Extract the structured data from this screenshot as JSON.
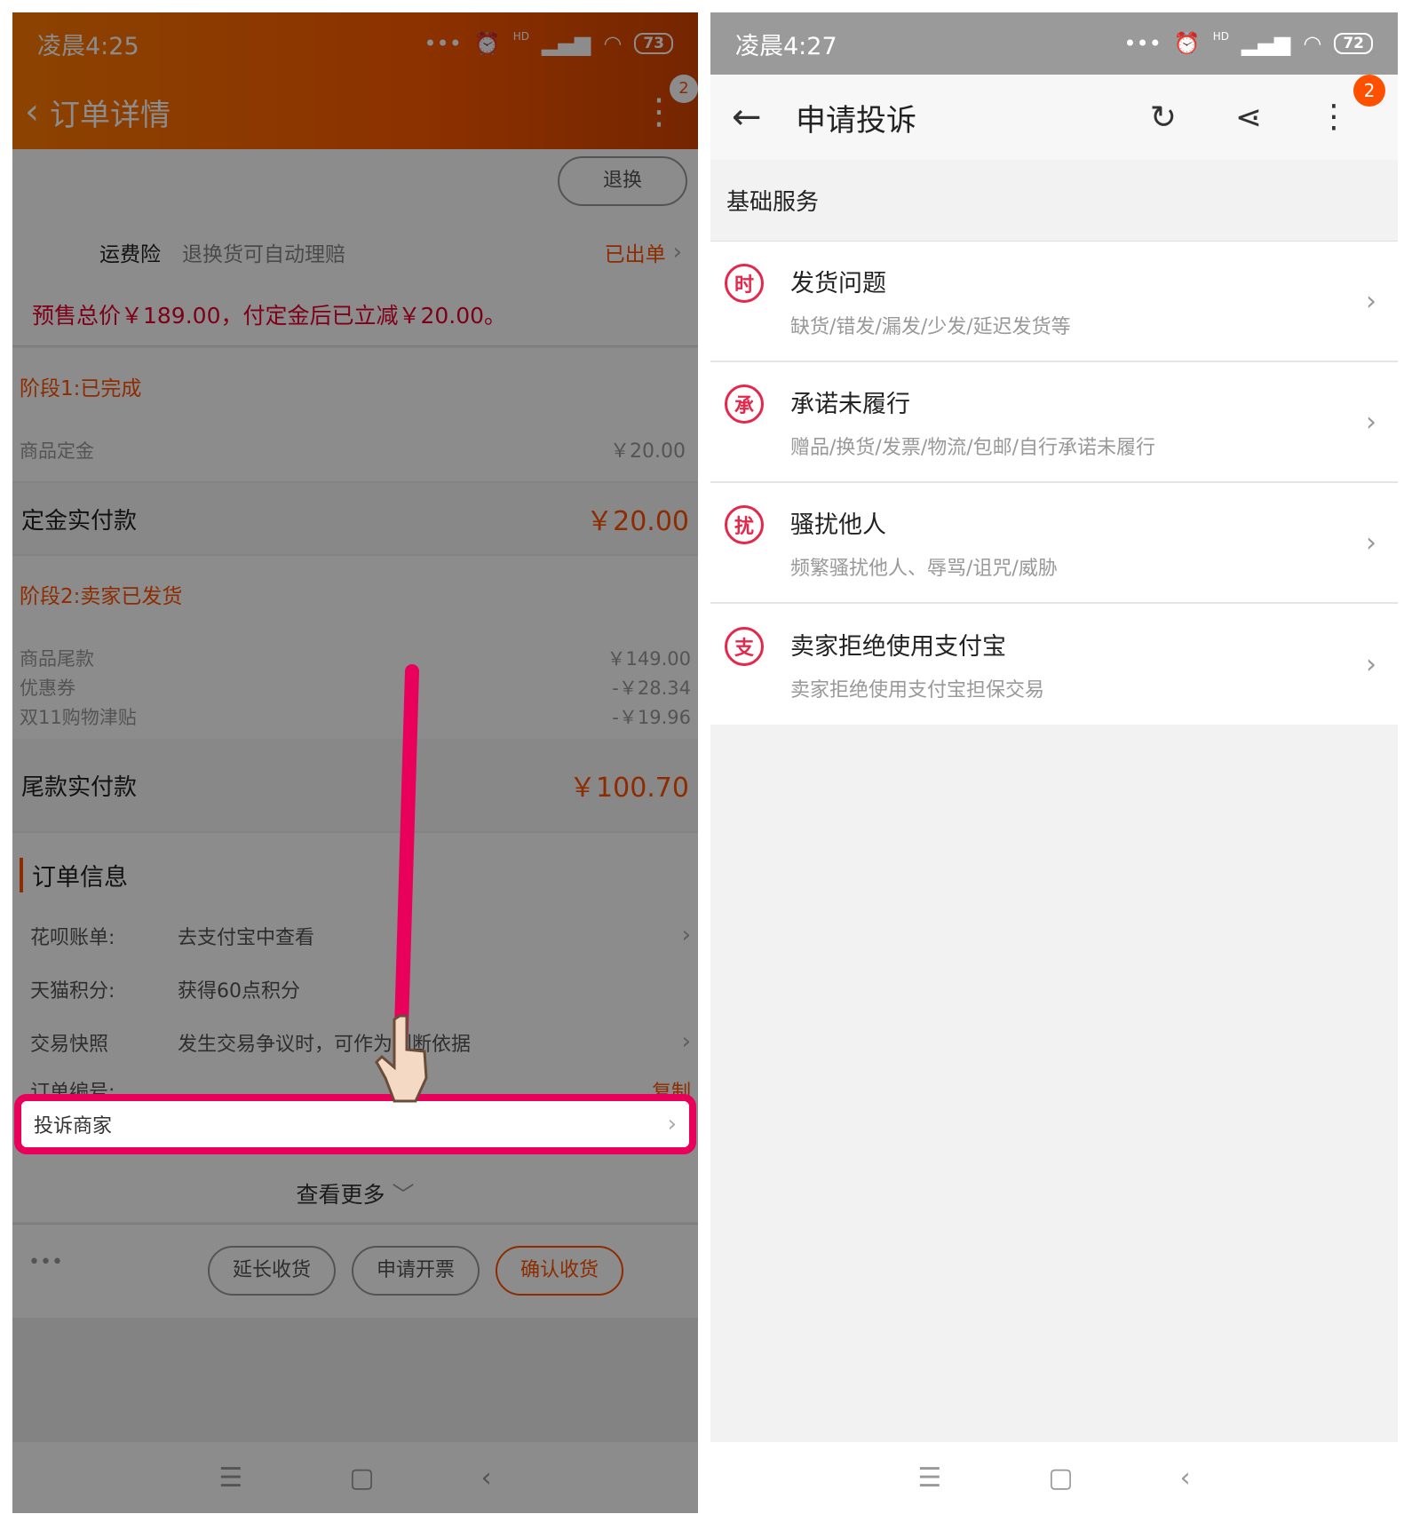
{
  "left": {
    "status": {
      "time": "凌晨4:25",
      "dots": "•••",
      "hd": "HD",
      "battery": "73"
    },
    "header": {
      "back": "‹",
      "title": "订单详情",
      "more": "⋮",
      "badge": "2"
    },
    "return_button": "退换",
    "insurance": {
      "label": "运费险",
      "desc": "退换货可自动理赔",
      "status": "已出单",
      "chevron": "›"
    },
    "presale_note": "预售总价￥189.00，付定金后已立减￥20.00。",
    "stage1": {
      "title": "阶段1:已完成",
      "deposit_label": "商品定金",
      "deposit_value": "￥20.00",
      "paid_label": "定金实付款",
      "paid_value": "￥20.00"
    },
    "stage2": {
      "title": "阶段2:卖家已发货",
      "rows": [
        {
          "label": "商品尾款",
          "value": "￥149.00"
        },
        {
          "label": "优惠券",
          "value": "-￥28.34"
        },
        {
          "label": "双11购物津贴",
          "value": "-￥19.96"
        }
      ],
      "paid_label": "尾款实付款",
      "paid_value": "￥100.70"
    },
    "order_info": {
      "title": "订单信息",
      "rows": [
        {
          "label": "花呗账单:",
          "value": "去支付宝中查看",
          "chevron": "›"
        },
        {
          "label": "天猫积分:",
          "value": "获得60点积分",
          "chevron": ""
        },
        {
          "label": "交易快照",
          "value": "发生交易争议时，可作为判断依据",
          "chevron": "›"
        },
        {
          "label": "订单编号:",
          "value": "",
          "action": "复制"
        }
      ],
      "complain": {
        "label": "投诉商家",
        "chevron": "›"
      },
      "see_more": "查看更多",
      "see_more_icon": "﹀"
    },
    "bottom_bar": {
      "more": "•••",
      "extend": "延长收货",
      "invoice": "申请开票",
      "confirm": "确认收货"
    },
    "navbar": {
      "menu": "☰",
      "home": "▢",
      "back": "‹"
    },
    "colors": {
      "accent": "#ff5000",
      "highlight": "#e8005a",
      "arrow": "#e8005a"
    }
  },
  "right": {
    "status": {
      "time": "凌晨4:27",
      "dots": "•••",
      "hd": "HD",
      "battery": "72"
    },
    "header": {
      "back": "←",
      "title": "申请投诉",
      "refresh": "↻",
      "share": "⋖",
      "more": "⋮",
      "badge": "2"
    },
    "section": "基础服务",
    "items": [
      {
        "icon_text": "时",
        "title": "发货问题",
        "desc": "缺货/错发/漏发/少发/延迟发货等",
        "chevron": "›"
      },
      {
        "icon_text": "承",
        "title": "承诺未履行",
        "desc": "赠品/换货/发票/物流/包邮/自行承诺未履行",
        "chevron": "›"
      },
      {
        "icon_text": "扰",
        "title": "骚扰他人",
        "desc": "频繁骚扰他人、辱骂/诅咒/威胁",
        "chevron": "›"
      },
      {
        "icon_text": "支",
        "title": "卖家拒绝使用支付宝",
        "desc": "卖家拒绝使用支付宝担保交易",
        "chevron": "›"
      }
    ],
    "navbar": {
      "menu": "☰",
      "home": "▢",
      "back": "‹"
    },
    "colors": {
      "icon_red": "#e4274a",
      "badge": "#ff5000"
    }
  }
}
